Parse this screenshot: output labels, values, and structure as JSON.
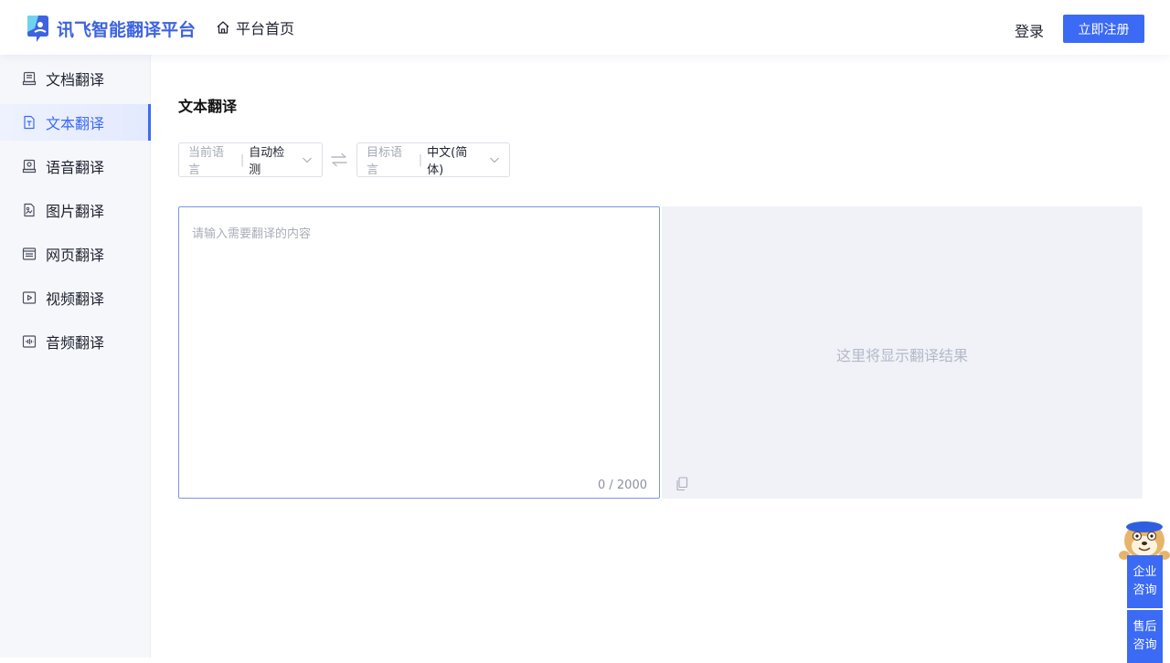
{
  "header": {
    "logo_text": "讯飞智能翻译平台",
    "home_label": "平台首页",
    "login_label": "登录",
    "register_label": "立即注册"
  },
  "sidebar": {
    "items": [
      {
        "label": "文档翻译",
        "icon": "document-icon",
        "active": false
      },
      {
        "label": "文本翻译",
        "icon": "text-file-icon",
        "active": true
      },
      {
        "label": "语音翻译",
        "icon": "voice-icon",
        "active": false
      },
      {
        "label": "图片翻译",
        "icon": "image-icon",
        "active": false
      },
      {
        "label": "网页翻译",
        "icon": "webpage-icon",
        "active": false
      },
      {
        "label": "视频翻译",
        "icon": "video-icon",
        "active": false
      },
      {
        "label": "音频翻译",
        "icon": "audio-icon",
        "active": false
      }
    ]
  },
  "main": {
    "title": "文本翻译",
    "source_lang": {
      "label": "当前语言",
      "value": "自动检测"
    },
    "target_lang": {
      "label": "目标语言",
      "value": "中文(简体)"
    },
    "input_placeholder": "请输入需要翻译的内容",
    "char_count": "0 / 2000",
    "output_placeholder": "这里将显示翻译结果"
  },
  "float": {
    "enterprise_line1": "企业",
    "enterprise_line2": "咨询",
    "aftersale_line1": "售后",
    "aftersale_line2": "咨询"
  },
  "colors": {
    "accent": "#3b6af5",
    "sidebar_bg": "#f6f7fb",
    "output_bg": "#f0f2f8"
  }
}
